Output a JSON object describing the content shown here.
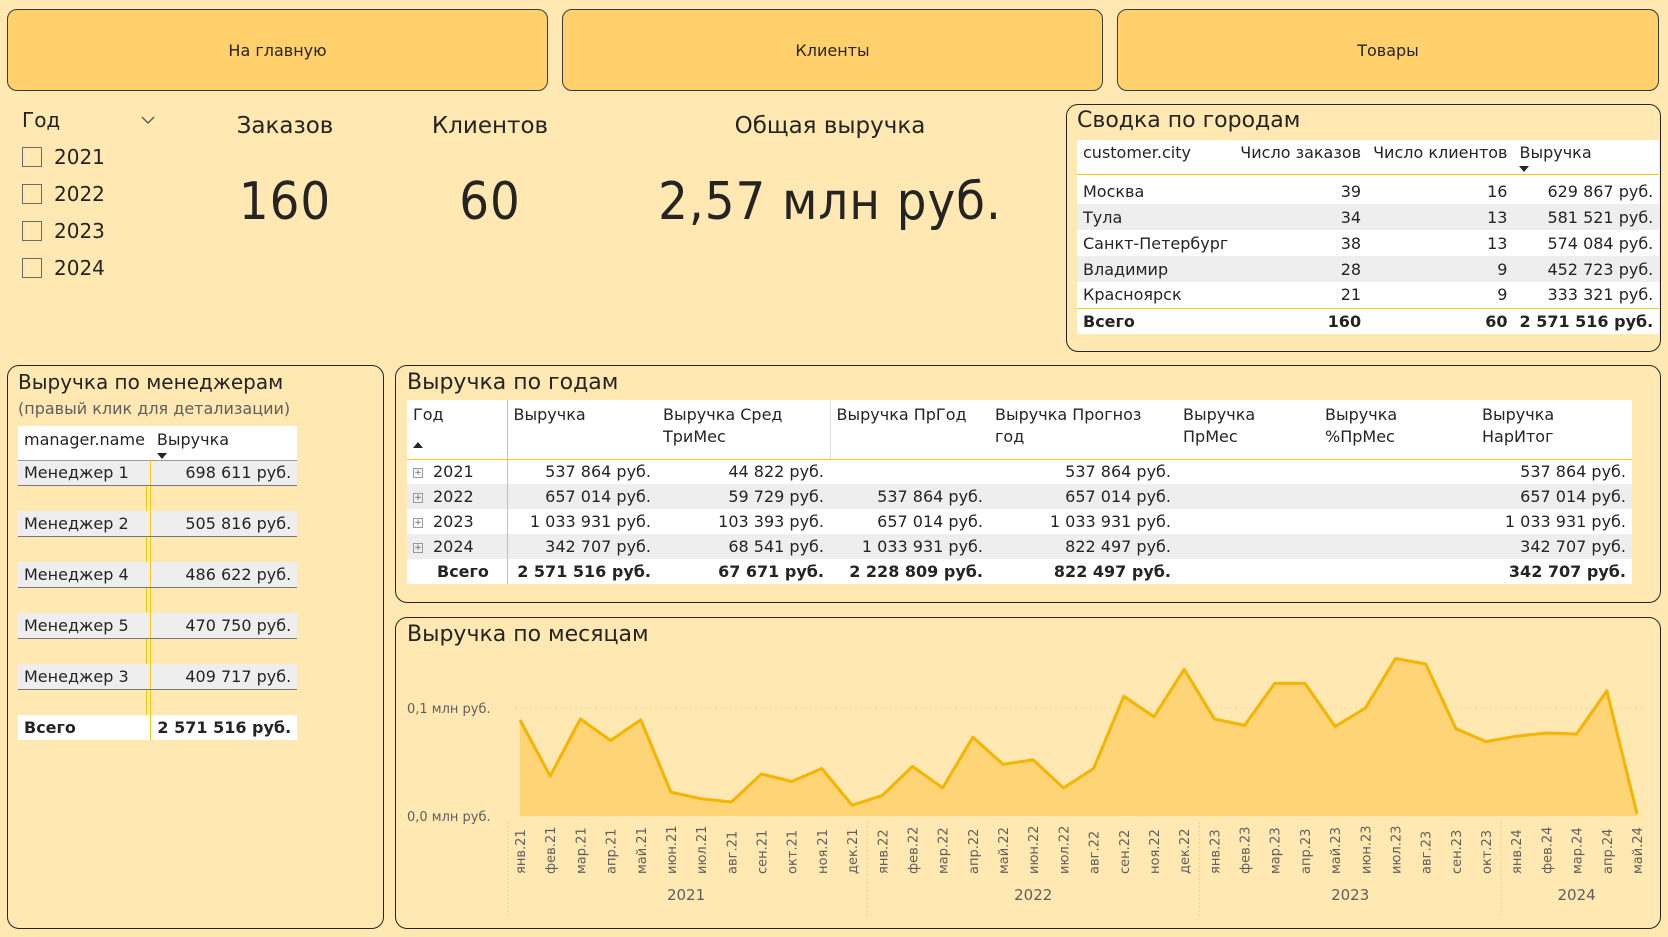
{
  "nav": {
    "home": "На главную",
    "clients": "Клиенты",
    "goods": "Товары"
  },
  "slicer": {
    "title": "Год",
    "items": [
      "2021",
      "2022",
      "2023",
      "2024"
    ]
  },
  "cards": {
    "orders": {
      "title": "Заказов",
      "value": "160"
    },
    "clients": {
      "title": "Клиентов",
      "value": "60"
    },
    "revenue": {
      "title": "Общая выручка",
      "value": "2,57 млн руб."
    }
  },
  "cities": {
    "title": "Сводка по городам",
    "headers": [
      "customer.city",
      "Число заказов",
      "Число клиентов",
      "Выручка"
    ],
    "rows": [
      [
        "Москва",
        "39",
        "16",
        "629 867 руб."
      ],
      [
        "Тула",
        "34",
        "13",
        "581 521 руб."
      ],
      [
        "Санкт-Петербург",
        "38",
        "13",
        "574 084 руб."
      ],
      [
        "Владимир",
        "28",
        "9",
        "452 723 руб."
      ],
      [
        "Красноярск",
        "21",
        "9",
        "333 321 руб."
      ]
    ],
    "total": [
      "Всего",
      "160",
      "60",
      "2 571 516 руб."
    ]
  },
  "managers": {
    "title": "Выручка по менеджерам",
    "subtitle": "(правый клик для детализации)",
    "headers": [
      "manager.name",
      "Выручка"
    ],
    "rows": [
      [
        "Менеджер 1",
        "698 611 руб."
      ],
      [
        "Менеджер 2",
        "505 816 руб."
      ],
      [
        "Менеджер 4",
        "486 622 руб."
      ],
      [
        "Менеджер 5",
        "470 750 руб."
      ],
      [
        "Менеджер 3",
        "409 717 руб."
      ]
    ],
    "total": [
      "Всего",
      "2 571 516 руб."
    ]
  },
  "years": {
    "title": "Выручка по годам",
    "headers": [
      "Год",
      "Выручка",
      "Выручка Сред ТриМес",
      "Выручка ПрГод",
      "Выручка Прогноз год",
      "Выручка ПрМес",
      "Выручка %ПрМес",
      "Выручка НарИтог"
    ],
    "rows": [
      [
        "2021",
        "537 864 руб.",
        "44 822 руб.",
        "",
        "537 864 руб.",
        "",
        "",
        "537 864 руб."
      ],
      [
        "2022",
        "657 014 руб.",
        "59 729 руб.",
        "537 864 руб.",
        "657 014 руб.",
        "",
        "",
        "657 014 руб."
      ],
      [
        "2023",
        "1 033 931 руб.",
        "103 393 руб.",
        "657 014 руб.",
        "1 033 931 руб.",
        "",
        "",
        "1 033 931 руб."
      ],
      [
        "2024",
        "342 707 руб.",
        "68 541 руб.",
        "1 033 931 руб.",
        "822 497 руб.",
        "",
        "",
        "342 707 руб."
      ]
    ],
    "total": [
      "Всего",
      "2 571 516 руб.",
      "67 671 руб.",
      "2 228 809 руб.",
      "822 497 руб.",
      "",
      "",
      "342 707 руб."
    ]
  },
  "chart_data": {
    "type": "area",
    "title": "Выручка по месяцам",
    "color": "#F5B400",
    "fill": "#FFD06C",
    "yticks": [
      "0,0 млн руб.",
      "0,1 млн руб."
    ],
    "ylim": [
      0,
      0.14
    ],
    "x": [
      "янв.21",
      "фев.21",
      "мар.21",
      "апр.21",
      "май.21",
      "июн.21",
      "июл.21",
      "авг.21",
      "сен.21",
      "окт.21",
      "ноя.21",
      "дек.21",
      "янв.22",
      "фев.22",
      "мар.22",
      "апр.22",
      "май.22",
      "июн.22",
      "июл.22",
      "авг.22",
      "сен.22",
      "ноя.22",
      "дек.22",
      "янв.23",
      "фев.23",
      "мар.23",
      "апр.23",
      "май.23",
      "июн.23",
      "июл.23",
      "авг.23",
      "сен.23",
      "окт.23",
      "янв.24",
      "фев.24",
      "мар.24",
      "апр.24",
      "май.24"
    ],
    "values": [
      0.089,
      0.037,
      0.09,
      0.07,
      0.089,
      0.022,
      0.016,
      0.013,
      0.039,
      0.032,
      0.044,
      0.01,
      0.019,
      0.046,
      0.026,
      0.073,
      0.048,
      0.052,
      0.026,
      0.044,
      0.111,
      0.092,
      0.136,
      0.09,
      0.084,
      0.123,
      0.123,
      0.083,
      0.1,
      0.146,
      0.141,
      0.081,
      0.069,
      0.074,
      0.077,
      0.076,
      0.116,
      0.002
    ],
    "year_groups": [
      {
        "label": "2021",
        "start": 0,
        "end": 11
      },
      {
        "label": "2022",
        "start": 12,
        "end": 22
      },
      {
        "label": "2023",
        "start": 23,
        "end": 32
      },
      {
        "label": "2024",
        "start": 33,
        "end": 37
      }
    ]
  }
}
